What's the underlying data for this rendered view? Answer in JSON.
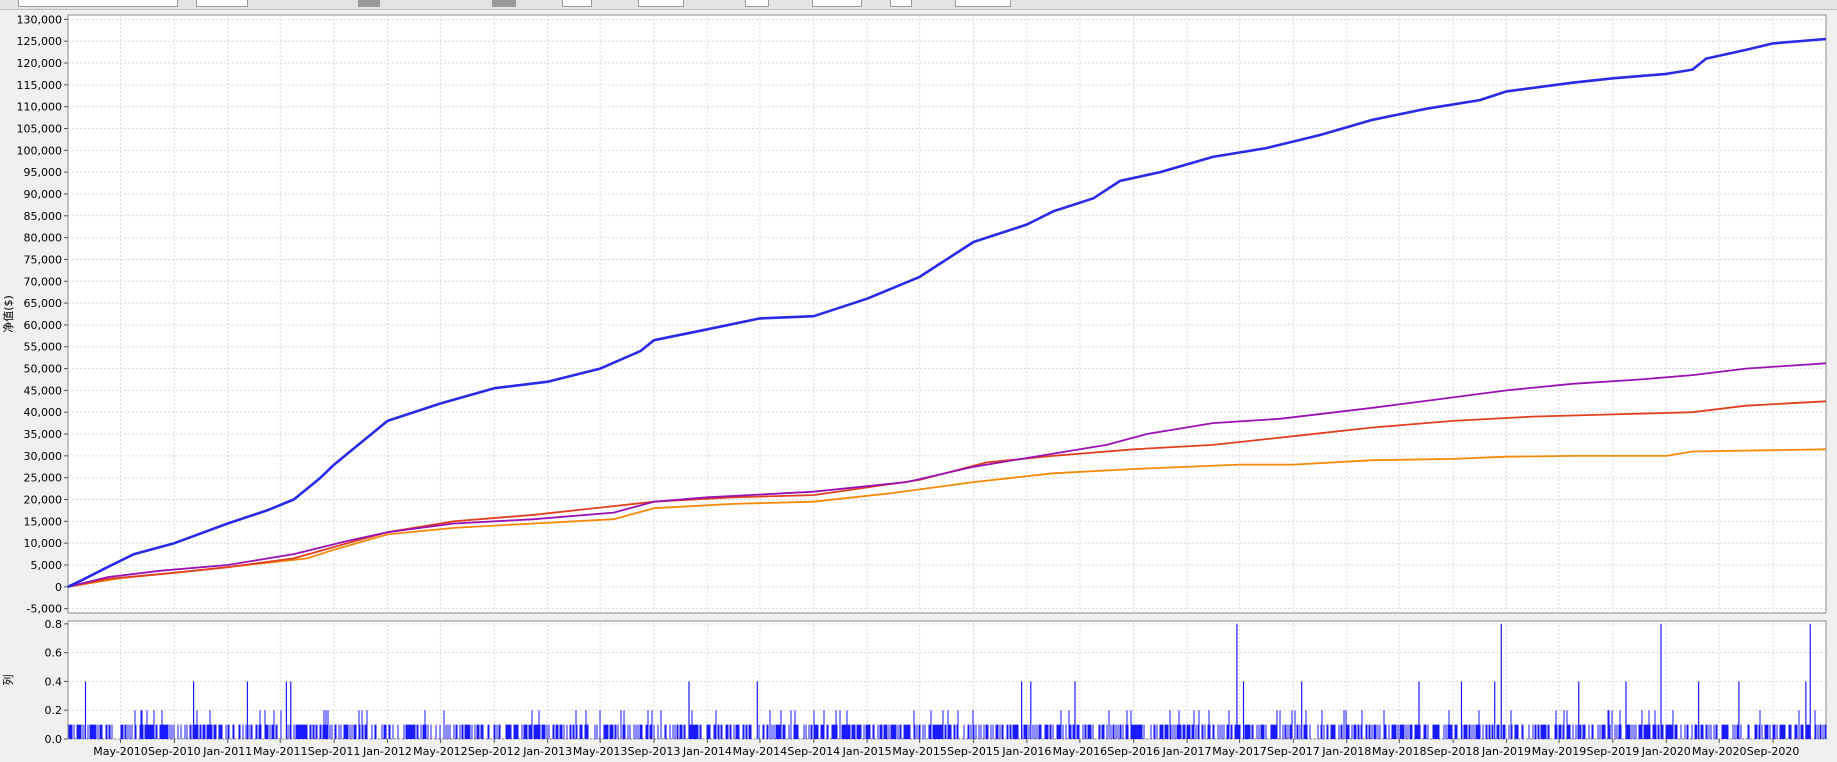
{
  "chart_data": [
    {
      "type": "line",
      "ylabel": "净值($)",
      "ylim": [
        -6000,
        131000
      ],
      "yticks": [
        -5000,
        0,
        5000,
        10000,
        15000,
        20000,
        25000,
        30000,
        35000,
        40000,
        45000,
        50000,
        55000,
        60000,
        65000,
        70000,
        75000,
        80000,
        85000,
        90000,
        95000,
        100000,
        105000,
        110000,
        115000,
        120000,
        125000,
        130000
      ],
      "ytick_labels": [
        "-5,000",
        "0",
        "5,000",
        "10,000",
        "15,000",
        "20,000",
        "25,000",
        "30,000",
        "35,000",
        "40,000",
        "45,000",
        "50,000",
        "55,000",
        "60,000",
        "65,000",
        "70,000",
        "75,000",
        "80,000",
        "85,000",
        "90,000",
        "95,000",
        "100,000",
        "105,000",
        "110,000",
        "115,000",
        "120,000",
        "125,000",
        "130,000"
      ],
      "xlim": [
        "2010-01-01",
        "2020-12-31"
      ],
      "grid": true,
      "series": [
        {
          "color": "#2a2ae6",
          "points": [
            [
              "2010-01-01",
              0
            ],
            [
              "2010-02-01",
              1500
            ],
            [
              "2010-04-01",
              4500
            ],
            [
              "2010-06-01",
              7500
            ],
            [
              "2010-09-01",
              10000
            ],
            [
              "2011-01-01",
              14500
            ],
            [
              "2011-04-01",
              17500
            ],
            [
              "2011-06-01",
              20000
            ],
            [
              "2011-08-01",
              25000
            ],
            [
              "2011-09-01",
              28000
            ],
            [
              "2011-11-01",
              33000
            ],
            [
              "2012-01-01",
              38000
            ],
            [
              "2012-05-01",
              42000
            ],
            [
              "2012-09-01",
              45500
            ],
            [
              "2013-01-01",
              47000
            ],
            [
              "2013-05-01",
              50000
            ],
            [
              "2013-08-01",
              54000
            ],
            [
              "2013-09-01",
              56500
            ],
            [
              "2014-01-01",
              59000
            ],
            [
              "2014-05-01",
              61500
            ],
            [
              "2014-09-01",
              62000
            ],
            [
              "2015-01-01",
              66000
            ],
            [
              "2015-05-01",
              71000
            ],
            [
              "2015-09-01",
              79000
            ],
            [
              "2016-01-01",
              83000
            ],
            [
              "2016-03-01",
              86000
            ],
            [
              "2016-06-01",
              89000
            ],
            [
              "2016-08-01",
              93000
            ],
            [
              "2016-11-01",
              95000
            ],
            [
              "2017-03-01",
              98500
            ],
            [
              "2017-07-01",
              100500
            ],
            [
              "2017-11-01",
              103500
            ],
            [
              "2018-03-01",
              107000
            ],
            [
              "2018-07-01",
              109500
            ],
            [
              "2018-11-01",
              111500
            ],
            [
              "2019-01-01",
              113500
            ],
            [
              "2019-06-01",
              115500
            ],
            [
              "2019-09-01",
              116500
            ],
            [
              "2020-01-01",
              117500
            ],
            [
              "2020-03-01",
              118500
            ],
            [
              "2020-04-01",
              121000
            ],
            [
              "2020-07-01",
              123000
            ],
            [
              "2020-09-01",
              124500
            ],
            [
              "2020-12-31",
              125500
            ]
          ]
        },
        {
          "color": "#9a12b4",
          "points": [
            [
              "2010-01-01",
              0
            ],
            [
              "2010-04-01",
              2200
            ],
            [
              "2010-08-01",
              3700
            ],
            [
              "2011-01-01",
              5000
            ],
            [
              "2011-06-01",
              7500
            ],
            [
              "2011-10-01",
              10500
            ],
            [
              "2012-01-01",
              12500
            ],
            [
              "2012-06-01",
              14500
            ],
            [
              "2012-12-01",
              15500
            ],
            [
              "2013-06-01",
              17000
            ],
            [
              "2013-09-01",
              19500
            ],
            [
              "2014-01-01",
              20500
            ],
            [
              "2014-09-01",
              21800
            ],
            [
              "2015-04-01",
              24000
            ],
            [
              "2015-09-01",
              27500
            ],
            [
              "2016-01-01",
              29500
            ],
            [
              "2016-07-01",
              32500
            ],
            [
              "2016-10-01",
              35000
            ],
            [
              "2017-03-01",
              37500
            ],
            [
              "2017-08-01",
              38500
            ],
            [
              "2018-03-01",
              41000
            ],
            [
              "2018-08-01",
              43000
            ],
            [
              "2019-01-01",
              45000
            ],
            [
              "2019-06-01",
              46500
            ],
            [
              "2019-11-01",
              47500
            ],
            [
              "2020-03-01",
              48500
            ],
            [
              "2020-07-01",
              50000
            ],
            [
              "2020-12-31",
              51200
            ]
          ]
        },
        {
          "color": "#e0401e",
          "points": [
            [
              "2010-01-01",
              0
            ],
            [
              "2010-04-01",
              1800
            ],
            [
              "2010-09-01",
              3200
            ],
            [
              "2011-01-01",
              4500
            ],
            [
              "2011-06-01",
              6500
            ],
            [
              "2011-10-01",
              10000
            ],
            [
              "2012-01-01",
              12500
            ],
            [
              "2012-06-01",
              15000
            ],
            [
              "2012-12-01",
              16500
            ],
            [
              "2013-06-01",
              18500
            ],
            [
              "2013-09-01",
              19500
            ],
            [
              "2014-03-01",
              20500
            ],
            [
              "2014-09-01",
              21000
            ],
            [
              "2015-05-01",
              24500
            ],
            [
              "2015-10-01",
              28500
            ],
            [
              "2016-03-01",
              30000
            ],
            [
              "2016-09-01",
              31500
            ],
            [
              "2017-03-01",
              32500
            ],
            [
              "2017-09-01",
              34500
            ],
            [
              "2018-03-01",
              36500
            ],
            [
              "2018-09-01",
              38000
            ],
            [
              "2019-03-01",
              39000
            ],
            [
              "2019-09-01",
              39500
            ],
            [
              "2020-03-01",
              40000
            ],
            [
              "2020-07-01",
              41500
            ],
            [
              "2020-12-31",
              42500
            ]
          ]
        },
        {
          "color": "#f58a0a",
          "points": [
            [
              "2010-01-01",
              0
            ],
            [
              "2010-05-01",
              2000
            ],
            [
              "2010-10-01",
              3500
            ],
            [
              "2011-04-01",
              5500
            ],
            [
              "2011-07-01",
              6500
            ],
            [
              "2011-09-01",
              8500
            ],
            [
              "2012-01-01",
              12000
            ],
            [
              "2012-06-01",
              13500
            ],
            [
              "2012-12-01",
              14500
            ],
            [
              "2013-06-01",
              15500
            ],
            [
              "2013-09-01",
              18000
            ],
            [
              "2014-03-01",
              19000
            ],
            [
              "2014-09-01",
              19500
            ],
            [
              "2015-03-01",
              21500
            ],
            [
              "2015-09-01",
              24000
            ],
            [
              "2016-03-01",
              26000
            ],
            [
              "2016-09-01",
              27000
            ],
            [
              "2017-05-01",
              28000
            ],
            [
              "2017-09-01",
              28000
            ],
            [
              "2018-03-01",
              29000
            ],
            [
              "2018-09-01",
              29300
            ],
            [
              "2019-01-01",
              29800
            ],
            [
              "2019-06-01",
              30000
            ],
            [
              "2020-01-01",
              30000
            ],
            [
              "2020-03-01",
              31000
            ],
            [
              "2020-12-31",
              31500
            ]
          ]
        }
      ]
    },
    {
      "type": "bar",
      "ylabel": "列",
      "ylim": [
        0,
        0.82
      ],
      "yticks": [
        0,
        0.2,
        0.4,
        0.6,
        0.8
      ],
      "ytick_labels": [
        "0.0",
        "0.2",
        "0.4",
        "0.6",
        "0.8"
      ],
      "grid": true,
      "color": "#1a1aff",
      "base_value": 0.1,
      "peaks": [
        [
          "2010-02-10",
          0.4
        ],
        [
          "2010-10-15",
          0.4
        ],
        [
          "2011-02-15",
          0.4
        ],
        [
          "2011-05-15",
          0.4
        ],
        [
          "2011-05-25",
          0.4
        ],
        [
          "2013-11-20",
          0.4
        ],
        [
          "2014-04-25",
          0.4
        ],
        [
          "2015-12-20",
          0.4
        ],
        [
          "2016-01-10",
          0.4
        ],
        [
          "2016-04-20",
          0.4
        ],
        [
          "2017-04-25",
          0.8
        ],
        [
          "2017-05-10",
          0.4
        ],
        [
          "2017-09-20",
          0.4
        ],
        [
          "2018-06-15",
          0.4
        ],
        [
          "2018-09-20",
          0.4
        ],
        [
          "2018-12-05",
          0.4
        ],
        [
          "2018-12-20",
          0.8
        ],
        [
          "2019-06-15",
          0.4
        ],
        [
          "2019-10-01",
          0.4
        ],
        [
          "2019-12-20",
          0.8
        ],
        [
          "2020-03-15",
          0.4
        ],
        [
          "2020-06-15",
          0.4
        ],
        [
          "2020-11-15",
          0.4
        ],
        [
          "2020-11-25",
          0.8
        ]
      ],
      "x": [
        "2010-05-01",
        "2010-09-01",
        "2011-01-01",
        "2011-05-01",
        "2011-09-01",
        "2012-01-01",
        "2012-05-01",
        "2012-09-01",
        "2013-01-01",
        "2013-05-01",
        "2013-09-01",
        "2014-01-01",
        "2014-05-01",
        "2014-09-01",
        "2015-01-01",
        "2015-05-01",
        "2015-09-01",
        "2016-01-01",
        "2016-05-01",
        "2016-09-01",
        "2017-01-01",
        "2017-05-01",
        "2017-09-01",
        "2018-01-01",
        "2018-05-01",
        "2018-09-01",
        "2019-01-01",
        "2019-05-01",
        "2019-09-01",
        "2020-01-01",
        "2020-05-01",
        "2020-09-01"
      ],
      "categories": [
        "May-2010",
        "Sep-2010",
        "Jan-2011",
        "May-2011",
        "Sep-2011",
        "Jan-2012",
        "May-2012",
        "Sep-2012",
        "Jan-2013",
        "May-2013",
        "Sep-2013",
        "Jan-2014",
        "May-2014",
        "Sep-2014",
        "Jan-2015",
        "May-2015",
        "Sep-2015",
        "Jan-2016",
        "May-2016",
        "Sep-2016",
        "Jan-2017",
        "May-2017",
        "Sep-2017",
        "Jan-2018",
        "May-2018",
        "Sep-2018",
        "Jan-2019",
        "May-2019",
        "Sep-2019",
        "Jan-2020",
        "May-2020",
        "Sep-2020"
      ]
    }
  ]
}
